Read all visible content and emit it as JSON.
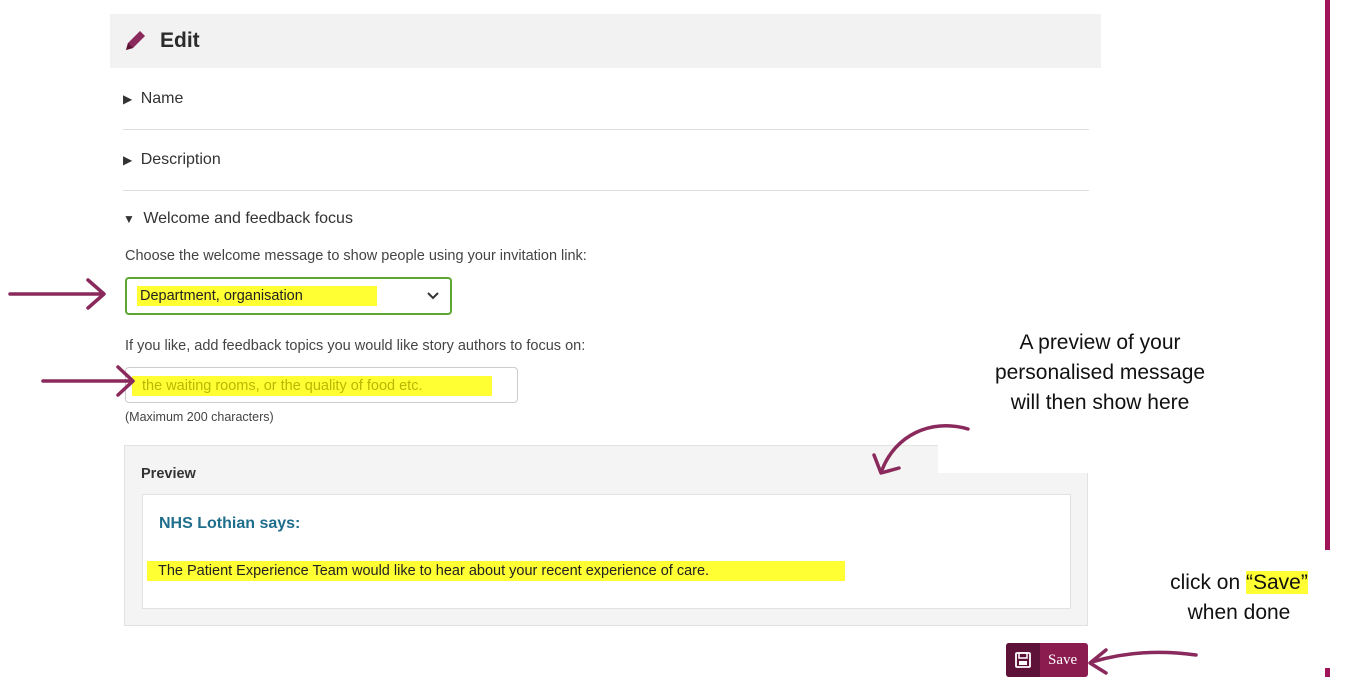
{
  "header": {
    "title": "Edit",
    "icon": "pencil-icon"
  },
  "sections": {
    "name_label": "Name",
    "description_label": "Description",
    "welcome_label": "Welcome and feedback focus",
    "collapsed_marker": "▶",
    "expanded_marker": "▼"
  },
  "welcome": {
    "instruction": "Choose the welcome message to show people using your invitation link:",
    "selected": "Department, organisation"
  },
  "topics": {
    "instruction": "If you like, add feedback topics you would like story authors to focus on:",
    "value": "the waiting rooms, or the quality of food etc.",
    "note": "(Maximum 200 characters)"
  },
  "preview": {
    "title": "Preview",
    "org_says": "NHS Lothian says:",
    "message": "The Patient Experience Team would like to hear about your recent experience of care."
  },
  "save_button": {
    "label": "Save",
    "icon": "floppy-disk-icon"
  },
  "annotations": {
    "preview_line1": "A preview of your",
    "preview_line2": "personalised message",
    "preview_line3": "will then show here",
    "save_prefix": "click on ",
    "save_highlight": "“Save”",
    "save_line2": "when done"
  },
  "colors": {
    "arrow": "#8a2a5c",
    "highlight": "#ffff33",
    "brand": "#8a1c4f",
    "select_border": "#5aa832",
    "org_text": "#1f6e8c"
  }
}
